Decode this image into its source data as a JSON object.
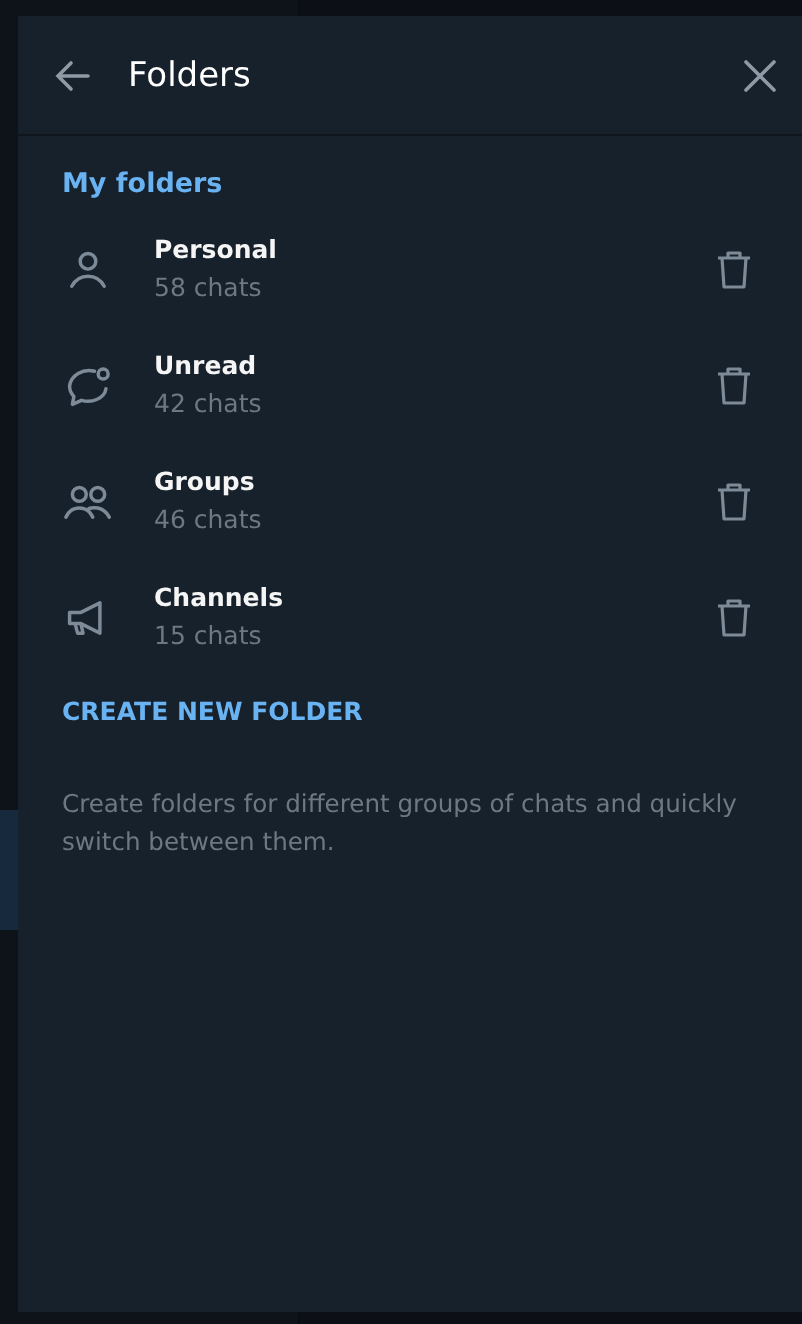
{
  "dialog": {
    "title": "Folders"
  },
  "section_title": "My folders",
  "folders": [
    {
      "kind": "person",
      "name": "Personal",
      "count": "58 chats"
    },
    {
      "kind": "bubble",
      "name": "Unread",
      "count": "42 chats"
    },
    {
      "kind": "people",
      "name": "Groups",
      "count": "46 chats"
    },
    {
      "kind": "megaphone",
      "name": "Channels",
      "count": "15 chats"
    }
  ],
  "create_button": "CREATE NEW FOLDER",
  "description": "Create folders for different groups of chats and quickly switch between them."
}
